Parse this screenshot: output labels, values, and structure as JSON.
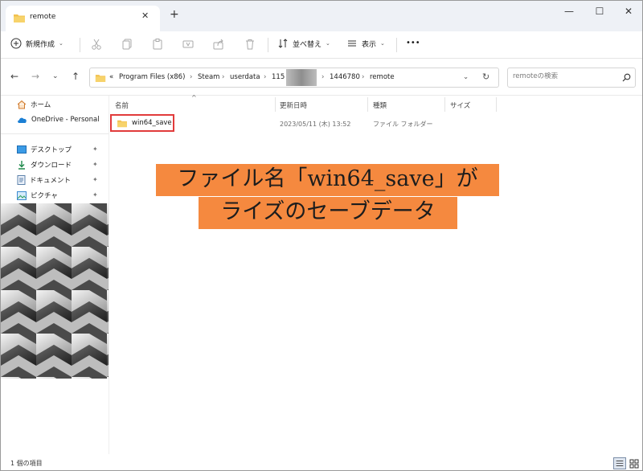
{
  "window": {
    "tab_title": "remote",
    "new_tab": "+",
    "minimize": "—",
    "maximize": "☐",
    "close": "✕"
  },
  "toolbar": {
    "new_label": "新規作成",
    "sort_label": "並べ替え",
    "view_label": "表示",
    "more_label": "•••"
  },
  "address": {
    "chevrons": "«",
    "segments": [
      "Program Files (x86)",
      "Steam",
      "userdata",
      "115",
      "1446780",
      "remote"
    ],
    "separator": "›"
  },
  "search": {
    "placeholder": "remoteの検索"
  },
  "sidebar": {
    "items": [
      {
        "label": "ホーム",
        "icon": "home-icon"
      },
      {
        "label": "OneDrive - Personal",
        "icon": "cloud-icon"
      },
      {
        "label": "デスクトップ",
        "icon": "desktop-icon"
      },
      {
        "label": "ダウンロード",
        "icon": "download-icon"
      },
      {
        "label": "ドキュメント",
        "icon": "document-icon"
      },
      {
        "label": "ピクチャ",
        "icon": "picture-icon"
      }
    ],
    "pin": "📌"
  },
  "columns": [
    "名前",
    "更新日時",
    "種類",
    "サイズ"
  ],
  "files": [
    {
      "name": "win64_save",
      "modified": "2023/05/11 (木) 13:52",
      "type": "ファイル フォルダー",
      "size": ""
    }
  ],
  "callout": {
    "line1": "ファイル名「win64_save」が",
    "line2": "ライズのセーブデータ"
  },
  "status": {
    "count": "1 個の項目"
  },
  "colors": {
    "accent": "#f5893f",
    "highlight_border": "#e13b3b",
    "folder": "#f2c14e"
  }
}
